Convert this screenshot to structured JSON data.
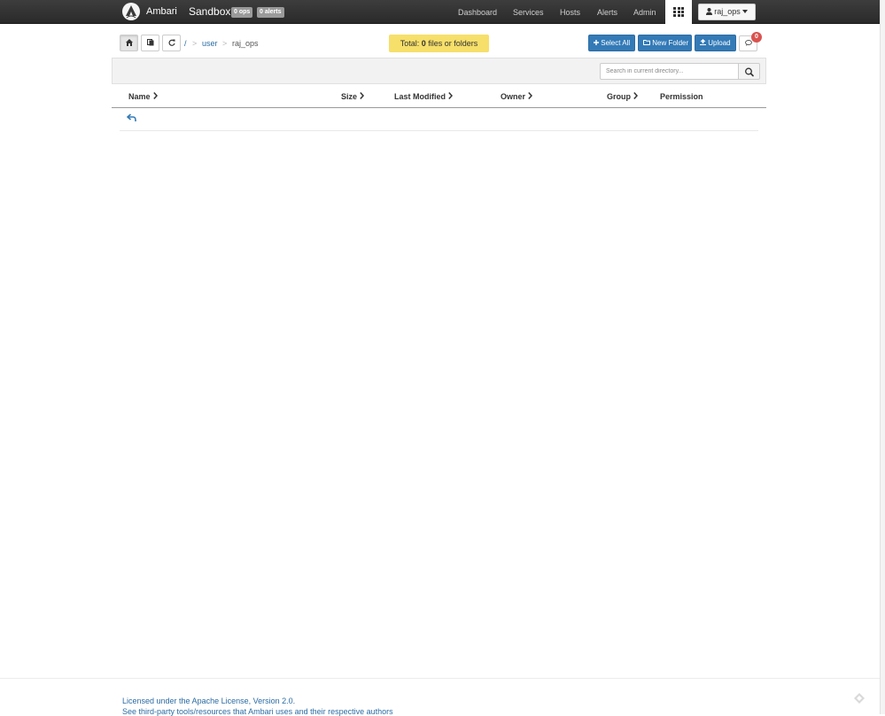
{
  "nav": {
    "brand": "Ambari",
    "cluster": "Sandbox",
    "ops_badge": "0 ops",
    "alerts_badge": "0 alerts",
    "links": [
      "Dashboard",
      "Services",
      "Hosts",
      "Alerts",
      "Admin"
    ],
    "user": "raj_ops"
  },
  "toolbar": {
    "breadcrumb": {
      "root": "/",
      "separator": ">",
      "user": "user",
      "current": "raj_ops"
    },
    "total_prefix": "Total:",
    "total_count": "0",
    "total_suffix": "files or folders",
    "select_all": "Select All",
    "new_folder": "New Folder",
    "upload": "Upload",
    "notifications": "0"
  },
  "search": {
    "placeholder": "Search in current directory..."
  },
  "table": {
    "columns": [
      "Name",
      "Size",
      "Last Modified",
      "Owner",
      "Group",
      "Permission"
    ]
  },
  "footer": {
    "license": "Licensed under the Apache License, Version 2.0.",
    "third_party": "See third-party tools/resources that Ambari uses and their respective authors"
  },
  "colors": {
    "navbar": "#333333",
    "primary": "#337ab7",
    "banner": "#f6df6a",
    "badge": "#d9534f"
  }
}
